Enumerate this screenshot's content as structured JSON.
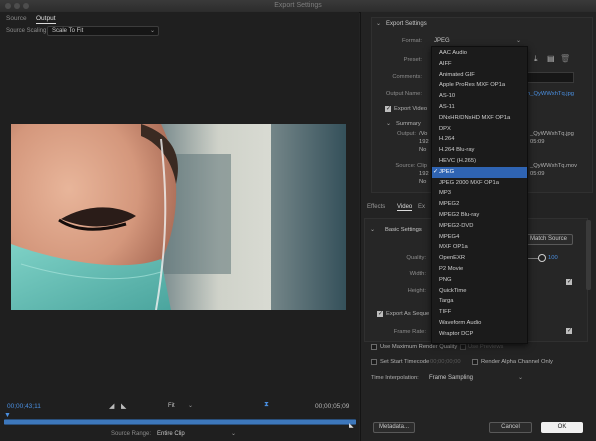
{
  "window": {
    "title": "Export Settings"
  },
  "left": {
    "tabs": [
      {
        "label": "Source"
      },
      {
        "label": "Output"
      }
    ],
    "source_scaling": {
      "label": "Source Scaling:",
      "value": "Scale To Fit"
    },
    "timeline": {
      "current_tc": "00;00;43;11",
      "end_tc": "00;00;05;09",
      "fit": "Fit",
      "source_range_label": "Source Range:",
      "source_range_value": "Entire Clip"
    }
  },
  "export_settings": {
    "header": "Export Settings",
    "format_label": "Format:",
    "format_value": "JPEG",
    "preset_label": "Preset:",
    "comments_label": "Comments:",
    "output_name_label": "Output Name:",
    "output_name_value": "n_QyWWxhTq.jpg",
    "export_video_label": "Export Video",
    "summary_label": "Summary",
    "output_label": "Output:",
    "output_lines": [
      "/Vo",
      "192",
      "No"
    ],
    "output_right": [
      "_QyWWxhTq.jpg",
      "05:09"
    ],
    "source_label": "Source: Clip",
    "source_lines": [
      "192",
      "No"
    ],
    "source_right": [
      "_QyWWxhTq.mov",
      "05:09"
    ]
  },
  "tabs2": [
    {
      "label": "Effects"
    },
    {
      "label": "Video"
    },
    {
      "label": "Ex"
    }
  ],
  "basic_settings": {
    "header": "Basic Settings",
    "match_source": "Match Source",
    "quality_label": "Quality:",
    "quality_value": "100",
    "width_label": "Width:",
    "height_label": "Height:",
    "export_seq_label": "Export As Seque",
    "frame_rate_label": "Frame Rate:"
  },
  "bottom": {
    "use_max_quality": "Use Maximum Render Quality",
    "use_previews": "Use Previews",
    "set_start_tc": "Set Start Timecode",
    "start_tc_value": "00;00;00;00",
    "render_alpha": "Render Alpha Channel Only",
    "time_interp_label": "Time Interpolation:",
    "time_interp_value": "Frame Sampling",
    "metadata_btn": "Metadata...",
    "cancel_btn": "Cancel",
    "ok_btn": "OK"
  },
  "format_menu": [
    "AAC Audio",
    "AIFF",
    "Animated GIF",
    "Apple ProRes MXF OP1a",
    "AS-10",
    "AS-11",
    "DNxHR/DNxHD MXF OP1a",
    "DPX",
    "H.264",
    "H.264 Blu-ray",
    "HEVC (H.265)",
    "JPEG",
    "JPEG 2000 MXF OP1a",
    "MP3",
    "MPEG2",
    "MPEG2 Blu-ray",
    "MPEG2-DVD",
    "MPEG4",
    "MXF OP1a",
    "OpenEXR",
    "P2 Movie",
    "PNG",
    "QuickTime",
    "Targa",
    "TIFF",
    "Waveform Audio",
    "Wraptor DCP"
  ],
  "format_menu_selected": "JPEG"
}
